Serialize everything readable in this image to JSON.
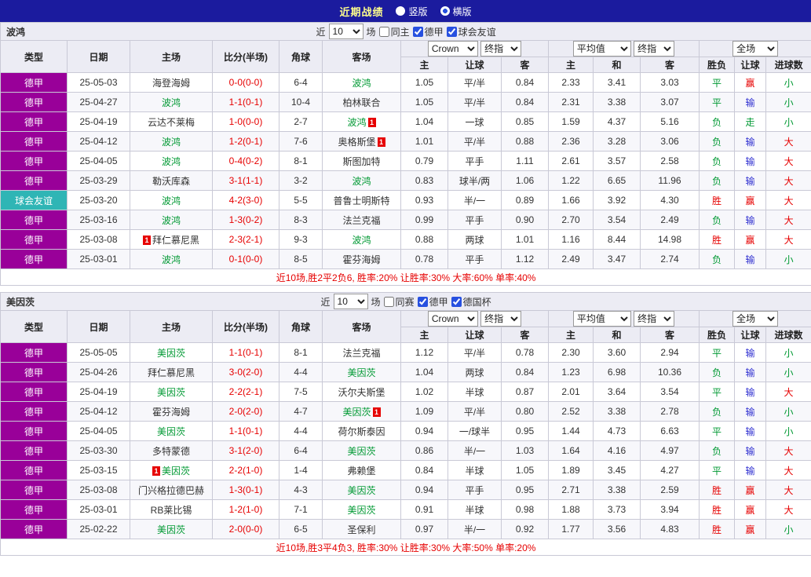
{
  "colors": {
    "red": "#e60000",
    "green": "#009933",
    "blue": "#2d2dd0",
    "league_purple": "#990099",
    "friendly_teal": "#2fb5b5",
    "titlebar_blue": "#1b1b9e",
    "header_lavender": "#ececf4"
  },
  "result_color_map": {
    "胜": "red",
    "平": "green",
    "负": "green",
    "赢": "red",
    "走": "green",
    "输": "blue",
    "大": "red",
    "小": "green"
  },
  "titlebar": {
    "title": "近期战绩",
    "view_options": [
      {
        "label": "竖版",
        "selected": false
      },
      {
        "label": "横版",
        "selected": true
      }
    ]
  },
  "table_header": {
    "static_cols": [
      "类型",
      "日期",
      "主场",
      "比分(半场)",
      "角球",
      "客场"
    ],
    "asia_selects": [
      "Crown",
      "终指"
    ],
    "euro_selects": [
      "平均值",
      "终指"
    ],
    "scope_select": "全场",
    "asia_cols": [
      "主",
      "让球",
      "客"
    ],
    "euro_cols": [
      "主",
      "和",
      "客"
    ],
    "result_cols": [
      "胜负",
      "让球",
      "进球数"
    ]
  },
  "sections": [
    {
      "team": "波鸿",
      "filter": {
        "prefix": "近",
        "count": "10",
        "suffix": "场",
        "checkboxes": [
          {
            "label": "同主",
            "checked": false
          },
          {
            "label": "德甲",
            "checked": true
          },
          {
            "label": "球会友谊",
            "checked": true
          }
        ]
      },
      "rows": [
        {
          "league": "德甲",
          "friendly": false,
          "date": "25-05-03",
          "home": {
            "name": "海登海姆",
            "focus": false
          },
          "score": "0-0(0-0)",
          "corner": "6-4",
          "away": {
            "name": "波鸿",
            "focus": true
          },
          "ah": [
            "1.05",
            "平/半",
            "0.84"
          ],
          "eu": [
            "2.33",
            "3.41",
            "3.03"
          ],
          "res": [
            "平",
            "赢",
            "小"
          ]
        },
        {
          "league": "德甲",
          "friendly": false,
          "date": "25-04-27",
          "home": {
            "name": "波鸿",
            "focus": true
          },
          "score": "1-1(0-1)",
          "corner": "10-4",
          "away": {
            "name": "柏林联合",
            "focus": false
          },
          "ah": [
            "1.05",
            "平/半",
            "0.84"
          ],
          "eu": [
            "2.31",
            "3.38",
            "3.07"
          ],
          "res": [
            "平",
            "输",
            "小"
          ]
        },
        {
          "league": "德甲",
          "friendly": false,
          "date": "25-04-19",
          "home": {
            "name": "云达不莱梅",
            "focus": false
          },
          "score": "1-0(0-0)",
          "corner": "2-7",
          "away": {
            "name": "波鸿",
            "focus": true,
            "card": "1",
            "card_pos": "after"
          },
          "ah": [
            "1.04",
            "一球",
            "0.85"
          ],
          "eu": [
            "1.59",
            "4.37",
            "5.16"
          ],
          "res": [
            "负",
            "走",
            "小"
          ]
        },
        {
          "league": "德甲",
          "friendly": false,
          "date": "25-04-12",
          "home": {
            "name": "波鸿",
            "focus": true
          },
          "score": "1-2(0-1)",
          "corner": "7-6",
          "away": {
            "name": "奥格斯堡",
            "focus": false,
            "card": "1",
            "card_pos": "after"
          },
          "ah": [
            "1.01",
            "平/半",
            "0.88"
          ],
          "eu": [
            "2.36",
            "3.28",
            "3.06"
          ],
          "res": [
            "负",
            "输",
            "大"
          ]
        },
        {
          "league": "德甲",
          "friendly": false,
          "date": "25-04-05",
          "home": {
            "name": "波鸿",
            "focus": true
          },
          "score": "0-4(0-2)",
          "corner": "8-1",
          "away": {
            "name": "斯图加特",
            "focus": false
          },
          "ah": [
            "0.79",
            "平手",
            "1.11"
          ],
          "eu": [
            "2.61",
            "3.57",
            "2.58"
          ],
          "res": [
            "负",
            "输",
            "大"
          ]
        },
        {
          "league": "德甲",
          "friendly": false,
          "date": "25-03-29",
          "home": {
            "name": "勒沃库森",
            "focus": false
          },
          "score": "3-1(1-1)",
          "corner": "3-2",
          "away": {
            "name": "波鸿",
            "focus": true
          },
          "ah": [
            "0.83",
            "球半/两",
            "1.06"
          ],
          "eu": [
            "1.22",
            "6.65",
            "11.96"
          ],
          "res": [
            "负",
            "输",
            "大"
          ]
        },
        {
          "league": "球会友谊",
          "friendly": true,
          "date": "25-03-20",
          "home": {
            "name": "波鸿",
            "focus": true
          },
          "score": "4-2(3-0)",
          "corner": "5-5",
          "away": {
            "name": "普鲁士明斯特",
            "focus": false
          },
          "ah": [
            "0.93",
            "半/一",
            "0.89"
          ],
          "eu": [
            "1.66",
            "3.92",
            "4.30"
          ],
          "res": [
            "胜",
            "赢",
            "大"
          ]
        },
        {
          "league": "德甲",
          "friendly": false,
          "date": "25-03-16",
          "home": {
            "name": "波鸿",
            "focus": true
          },
          "score": "1-3(0-2)",
          "corner": "8-3",
          "away": {
            "name": "法兰克福",
            "focus": false
          },
          "ah": [
            "0.99",
            "平手",
            "0.90"
          ],
          "eu": [
            "2.70",
            "3.54",
            "2.49"
          ],
          "res": [
            "负",
            "输",
            "大"
          ]
        },
        {
          "league": "德甲",
          "friendly": false,
          "date": "25-03-08",
          "home": {
            "name": "拜仁慕尼黑",
            "focus": false,
            "card": "1",
            "card_pos": "before"
          },
          "score": "2-3(2-1)",
          "corner": "9-3",
          "away": {
            "name": "波鸿",
            "focus": true
          },
          "ah": [
            "0.88",
            "两球",
            "1.01"
          ],
          "eu": [
            "1.16",
            "8.44",
            "14.98"
          ],
          "res": [
            "胜",
            "赢",
            "大"
          ]
        },
        {
          "league": "德甲",
          "friendly": false,
          "date": "25-03-01",
          "home": {
            "name": "波鸿",
            "focus": true
          },
          "score": "0-1(0-0)",
          "corner": "8-5",
          "away": {
            "name": "霍芬海姆",
            "focus": false
          },
          "ah": [
            "0.78",
            "平手",
            "1.12"
          ],
          "eu": [
            "2.49",
            "3.47",
            "2.74"
          ],
          "res": [
            "负",
            "输",
            "小"
          ]
        }
      ],
      "summary": "近10场,胜2平2负6, 胜率:20% 让胜率:30% 大率:60% 单率:40%"
    },
    {
      "team": "美因茨",
      "filter": {
        "prefix": "近",
        "count": "10",
        "suffix": "场",
        "checkboxes": [
          {
            "label": "同赛",
            "checked": false
          },
          {
            "label": "德甲",
            "checked": true
          },
          {
            "label": "德国杯",
            "checked": true
          }
        ]
      },
      "rows": [
        {
          "league": "德甲",
          "friendly": false,
          "date": "25-05-05",
          "home": {
            "name": "美因茨",
            "focus": true
          },
          "score": "1-1(0-1)",
          "corner": "8-1",
          "away": {
            "name": "法兰克福",
            "focus": false
          },
          "ah": [
            "1.12",
            "平/半",
            "0.78"
          ],
          "eu": [
            "2.30",
            "3.60",
            "2.94"
          ],
          "res": [
            "平",
            "输",
            "小"
          ]
        },
        {
          "league": "德甲",
          "friendly": false,
          "date": "25-04-26",
          "home": {
            "name": "拜仁慕尼黑",
            "focus": false
          },
          "score": "3-0(2-0)",
          "corner": "4-4",
          "away": {
            "name": "美因茨",
            "focus": true
          },
          "ah": [
            "1.04",
            "两球",
            "0.84"
          ],
          "eu": [
            "1.23",
            "6.98",
            "10.36"
          ],
          "res": [
            "负",
            "输",
            "小"
          ]
        },
        {
          "league": "德甲",
          "friendly": false,
          "date": "25-04-19",
          "home": {
            "name": "美因茨",
            "focus": true
          },
          "score": "2-2(2-1)",
          "corner": "7-5",
          "away": {
            "name": "沃尔夫斯堡",
            "focus": false
          },
          "ah": [
            "1.02",
            "半球",
            "0.87"
          ],
          "eu": [
            "2.01",
            "3.64",
            "3.54"
          ],
          "res": [
            "平",
            "输",
            "大"
          ]
        },
        {
          "league": "德甲",
          "friendly": false,
          "date": "25-04-12",
          "home": {
            "name": "霍芬海姆",
            "focus": false
          },
          "score": "2-0(2-0)",
          "corner": "4-7",
          "away": {
            "name": "美因茨",
            "focus": true,
            "card": "1",
            "card_pos": "after"
          },
          "ah": [
            "1.09",
            "平/半",
            "0.80"
          ],
          "eu": [
            "2.52",
            "3.38",
            "2.78"
          ],
          "res": [
            "负",
            "输",
            "小"
          ]
        },
        {
          "league": "德甲",
          "friendly": false,
          "date": "25-04-05",
          "home": {
            "name": "美因茨",
            "focus": true
          },
          "score": "1-1(0-1)",
          "corner": "4-4",
          "away": {
            "name": "荷尔斯泰因",
            "focus": false
          },
          "ah": [
            "0.94",
            "一/球半",
            "0.95"
          ],
          "eu": [
            "1.44",
            "4.73",
            "6.63"
          ],
          "res": [
            "平",
            "输",
            "小"
          ]
        },
        {
          "league": "德甲",
          "friendly": false,
          "date": "25-03-30",
          "home": {
            "name": "多特蒙德",
            "focus": false
          },
          "score": "3-1(2-0)",
          "corner": "6-4",
          "away": {
            "name": "美因茨",
            "focus": true
          },
          "ah": [
            "0.86",
            "半/一",
            "1.03"
          ],
          "eu": [
            "1.64",
            "4.16",
            "4.97"
          ],
          "res": [
            "负",
            "输",
            "大"
          ]
        },
        {
          "league": "德甲",
          "friendly": false,
          "date": "25-03-15",
          "home": {
            "name": "美因茨",
            "focus": true,
            "card": "1",
            "card_pos": "before"
          },
          "score": "2-2(1-0)",
          "corner": "1-4",
          "away": {
            "name": "弗赖堡",
            "focus": false
          },
          "ah": [
            "0.84",
            "半球",
            "1.05"
          ],
          "eu": [
            "1.89",
            "3.45",
            "4.27"
          ],
          "res": [
            "平",
            "输",
            "大"
          ]
        },
        {
          "league": "德甲",
          "friendly": false,
          "date": "25-03-08",
          "home": {
            "name": "门兴格拉德巴赫",
            "focus": false
          },
          "score": "1-3(0-1)",
          "corner": "4-3",
          "away": {
            "name": "美因茨",
            "focus": true
          },
          "ah": [
            "0.94",
            "平手",
            "0.95"
          ],
          "eu": [
            "2.71",
            "3.38",
            "2.59"
          ],
          "res": [
            "胜",
            "赢",
            "大"
          ]
        },
        {
          "league": "德甲",
          "friendly": false,
          "date": "25-03-01",
          "home": {
            "name": "RB莱比锡",
            "focus": false
          },
          "score": "1-2(1-0)",
          "corner": "7-1",
          "away": {
            "name": "美因茨",
            "focus": true
          },
          "ah": [
            "0.91",
            "半球",
            "0.98"
          ],
          "eu": [
            "1.88",
            "3.73",
            "3.94"
          ],
          "res": [
            "胜",
            "赢",
            "大"
          ]
        },
        {
          "league": "德甲",
          "friendly": false,
          "date": "25-02-22",
          "home": {
            "name": "美因茨",
            "focus": true
          },
          "score": "2-0(0-0)",
          "corner": "6-5",
          "away": {
            "name": "圣保利",
            "focus": false
          },
          "ah": [
            "0.97",
            "半/一",
            "0.92"
          ],
          "eu": [
            "1.77",
            "3.56",
            "4.83"
          ],
          "res": [
            "胜",
            "赢",
            "小"
          ]
        }
      ],
      "summary": "近10场,胜3平4负3, 胜率:30% 让胜率:30% 大率:50% 单率:20%"
    }
  ]
}
